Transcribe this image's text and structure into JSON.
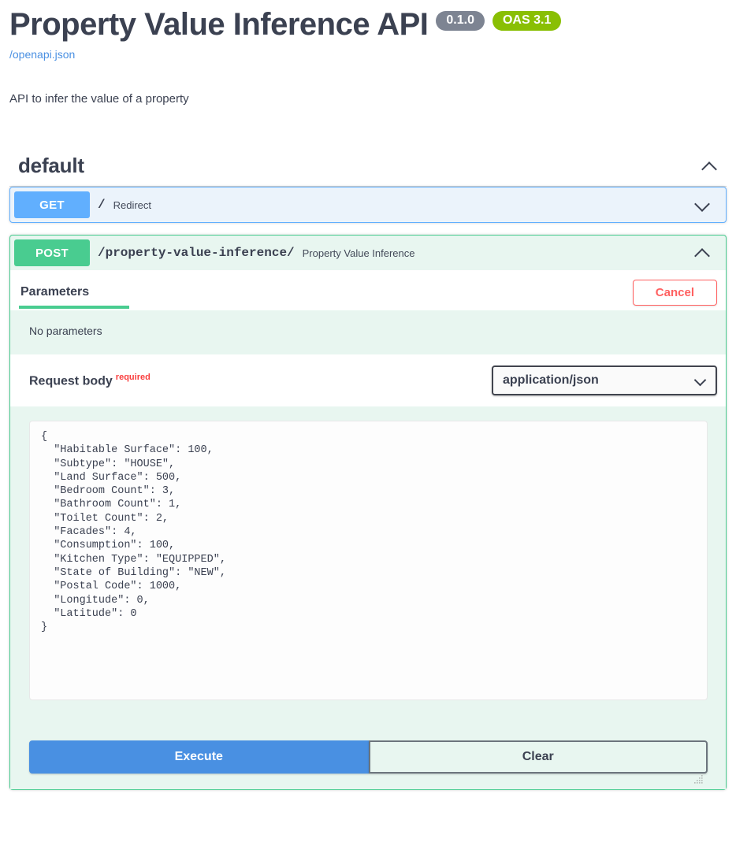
{
  "header": {
    "title": "Property Value Inference API",
    "version_badge": "0.1.0",
    "oas_badge": "OAS 3.1",
    "spec_url": "/openapi.json",
    "description": "API to infer the value of a property"
  },
  "tag": {
    "name": "default",
    "collapse_icon": "chevron-up-icon"
  },
  "operations": [
    {
      "method": "GET",
      "path": "/",
      "summary": "Redirect",
      "expanded": false,
      "toggle_icon": "chevron-down-icon"
    },
    {
      "method": "POST",
      "path": "/property-value-inference/",
      "summary": "Property Value Inference",
      "expanded": true,
      "toggle_icon": "chevron-up-icon"
    }
  ],
  "post_panel": {
    "tab_label": "Parameters",
    "cancel_label": "Cancel",
    "no_parameters_text": "No parameters",
    "request_body_label": "Request body",
    "required_label": "required",
    "content_type": {
      "selected": "application/json",
      "options": [
        "application/json"
      ],
      "chevron_icon": "chevron-down-icon"
    },
    "body_value": "{\n  \"Habitable Surface\": 100,\n  \"Subtype\": \"HOUSE\",\n  \"Land Surface\": 500,\n  \"Bedroom Count\": 3,\n  \"Bathroom Count\": 1,\n  \"Toilet Count\": 2,\n  \"Facades\": 4,\n  \"Consumption\": 100,\n  \"Kitchen Type\": \"EQUIPPED\",\n  \"State of Building\": \"NEW\",\n  \"Postal Code\": 1000,\n  \"Longitude\": 0,\n  \"Latitude\": 0\n}",
    "execute_label": "Execute",
    "clear_label": "Clear"
  },
  "colors": {
    "get": "#61affe",
    "post": "#49cc90",
    "execute": "#4990e2",
    "cancel": "#ff6060",
    "required": "#f93e3e",
    "oas_badge": "#89bf04",
    "version_badge": "#7d8492",
    "link": "#4a90e2",
    "text": "#3b4151"
  }
}
